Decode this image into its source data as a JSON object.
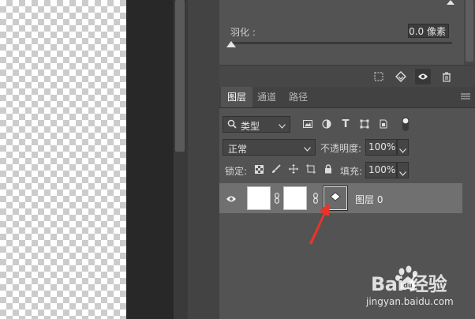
{
  "properties": {
    "feather_label": "羽化 :",
    "feather_value": "0.0 像素"
  },
  "tabs": [
    {
      "label": "图层",
      "active": true
    },
    {
      "label": "通道",
      "active": false
    },
    {
      "label": "路径",
      "active": false
    }
  ],
  "filter": {
    "kind_label": "类型"
  },
  "blend": {
    "mode": "正常",
    "opacity_label": "不透明度:",
    "opacity_value": "100%"
  },
  "lock": {
    "label": "锁定:",
    "fill_label": "填充:",
    "fill_value": "100%"
  },
  "layer": {
    "name": "图层 0"
  },
  "watermark": {
    "brand": "Bai 经验",
    "url": "jingyan.baidu.com"
  },
  "colors": {
    "panel_bg": "#535353",
    "selected_row": "#707070",
    "arrow": "#e8342a"
  },
  "icons": {
    "search": "search-icon",
    "visibility": "eye-icon",
    "delete": "trash-icon"
  }
}
